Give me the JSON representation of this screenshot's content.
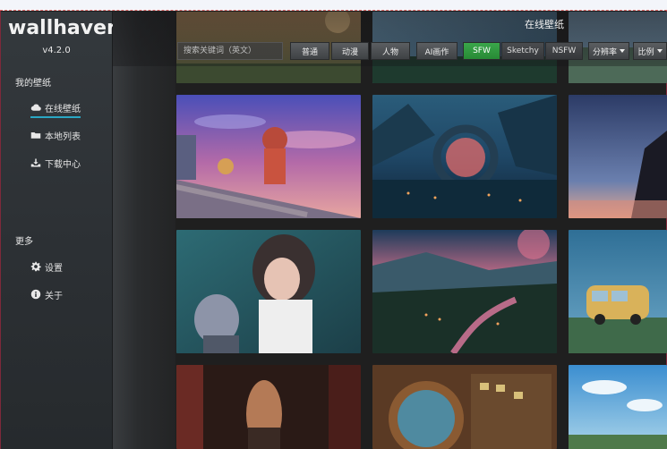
{
  "app": {
    "logo": "wallhaven",
    "version": "v4.2.0"
  },
  "sidebar": {
    "section_my": "我的壁纸",
    "items": [
      {
        "label": "在线壁纸",
        "icon": "cloud-icon",
        "active": true
      },
      {
        "label": "本地列表",
        "icon": "folder-icon",
        "active": false
      },
      {
        "label": "下载中心",
        "icon": "download-tray-icon",
        "active": false
      }
    ],
    "section_more": "更多",
    "more_items": [
      {
        "label": "设置",
        "icon": "gear-icon"
      },
      {
        "label": "关于",
        "icon": "info-icon"
      }
    ]
  },
  "header": {
    "title": "在线壁纸",
    "search_placeholder": "搜索关键词（英文）",
    "categories": [
      "普通",
      "动漫",
      "人物"
    ],
    "ai_button": "AI画作",
    "purity": [
      "SFW",
      "Sketchy",
      "NSFW"
    ],
    "purity_active": "SFW",
    "resolution": "分辨率",
    "ratio": "比例"
  },
  "colors": {
    "accent_green": "#2e9a3e",
    "active_underline": "#2aa7c4"
  }
}
